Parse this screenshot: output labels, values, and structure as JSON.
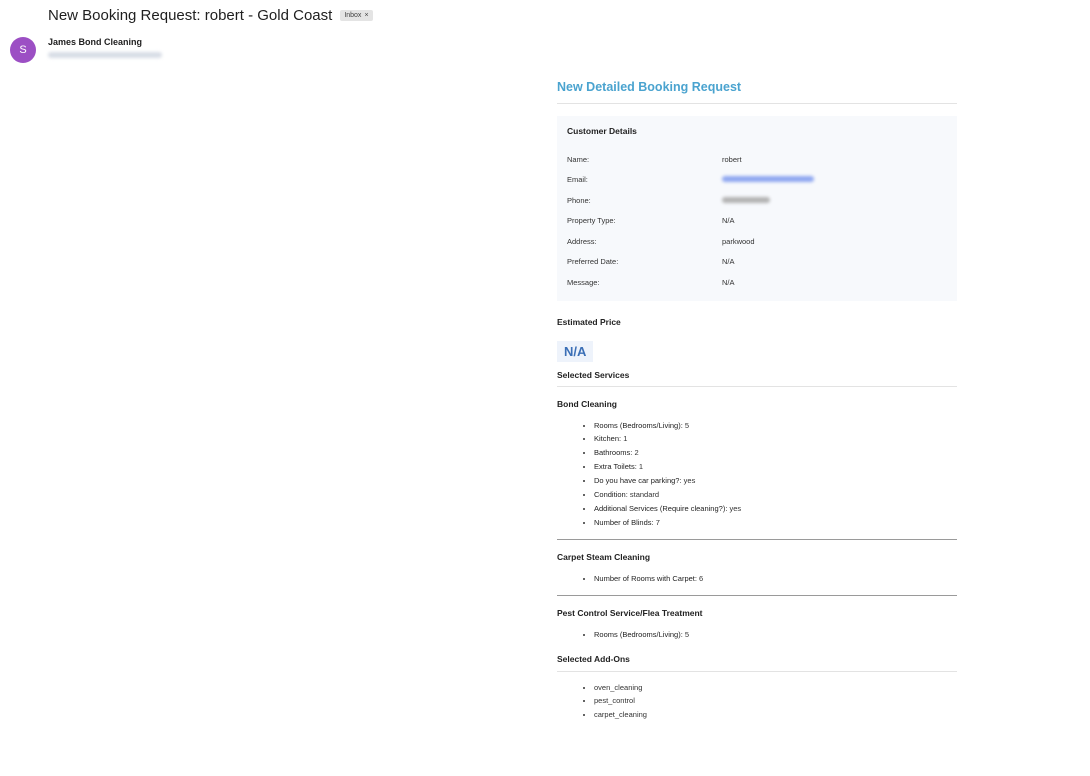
{
  "email": {
    "subject": "New Booking Request: robert - Gold Coast",
    "label_badge": "Inbox",
    "label_remove": "×",
    "sender_initial": "S",
    "sender_name": "James Bond Cleaning"
  },
  "body": {
    "title": "New Detailed Booking Request",
    "customer_heading": "Customer Details",
    "customer_details": [
      {
        "label": "Name:",
        "value": "robert"
      },
      {
        "label": "Email:",
        "value": ""
      },
      {
        "label": "Phone:",
        "value": ""
      },
      {
        "label": "Property Type:",
        "value": "N/A"
      },
      {
        "label": "Address:",
        "value": "parkwood"
      },
      {
        "label": "Preferred Date:",
        "value": "N/A"
      },
      {
        "label": "Message:",
        "value": "N/A"
      }
    ],
    "price_heading": "Estimated Price",
    "price_value": "N/A",
    "services_heading": "Selected Services",
    "services": [
      {
        "title": "Bond Cleaning",
        "items": [
          {
            "label": "Rooms (Bedrooms/Living):",
            "value": "5"
          },
          {
            "label": "Kitchen:",
            "value": "1"
          },
          {
            "label": "Bathrooms:",
            "value": "2"
          },
          {
            "label": "Extra Toilets:",
            "value": "1"
          },
          {
            "label": "Do you have car parking?:",
            "value": "yes"
          },
          {
            "label": "Condition:",
            "value": "standard"
          },
          {
            "label": "Additional Services (Require cleaning?):",
            "value": "yes"
          },
          {
            "label": "Number of Blinds:",
            "value": "7"
          }
        ]
      },
      {
        "title": "Carpet Steam Cleaning",
        "items": [
          {
            "label": "Number of Rooms with Carpet:",
            "value": "6"
          }
        ]
      },
      {
        "title": "Pest Control Service/Flea Treatment",
        "items": [
          {
            "label": "Rooms (Bedrooms/Living):",
            "value": "5"
          }
        ]
      }
    ],
    "addons_heading": "Selected Add-Ons",
    "addons": [
      "oven_cleaning",
      "pest_control",
      "carpet_cleaning"
    ]
  }
}
